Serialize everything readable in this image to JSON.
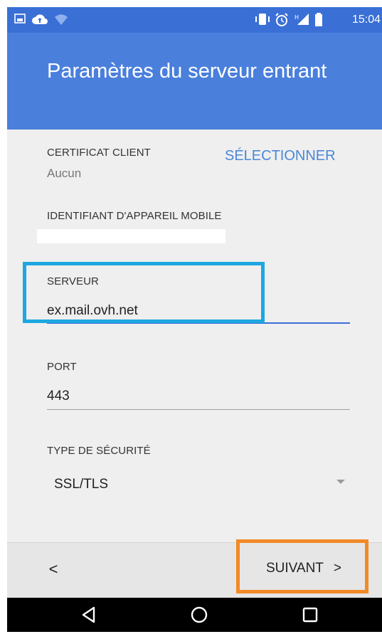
{
  "status_bar": {
    "time": "15:04"
  },
  "header": {
    "title": "Paramètres du serveur entrant"
  },
  "client_certificate": {
    "label": "CERTIFICAT CLIENT",
    "value": "Aucun",
    "action": "SÉLECTIONNER"
  },
  "device_id": {
    "label": "IDENTIFIANT D'APPAREIL MOBILE"
  },
  "server": {
    "label": "SERVEUR",
    "value": "ex.mail.ovh.net"
  },
  "port": {
    "label": "PORT",
    "value": "443"
  },
  "security_type": {
    "label": "TYPE DE SÉCURITÉ",
    "value": "SSL/TLS"
  },
  "footer": {
    "back_symbol": "<",
    "next_label": "SUIVANT",
    "next_symbol": ">"
  },
  "colors": {
    "header": "#4a7fdc",
    "status_bar": "#3a6fd6",
    "accent": "#4a87d9",
    "highlight_server": "#1ea7e1",
    "highlight_next": "#f28a26"
  },
  "icons": [
    "gallery-icon",
    "cloud-upload-icon",
    "wifi-icon",
    "vibrate-icon",
    "alarm-icon",
    "signal-icon",
    "battery-icon",
    "back-nav-icon",
    "home-nav-icon",
    "recents-nav-icon",
    "dropdown-arrow-icon"
  ]
}
